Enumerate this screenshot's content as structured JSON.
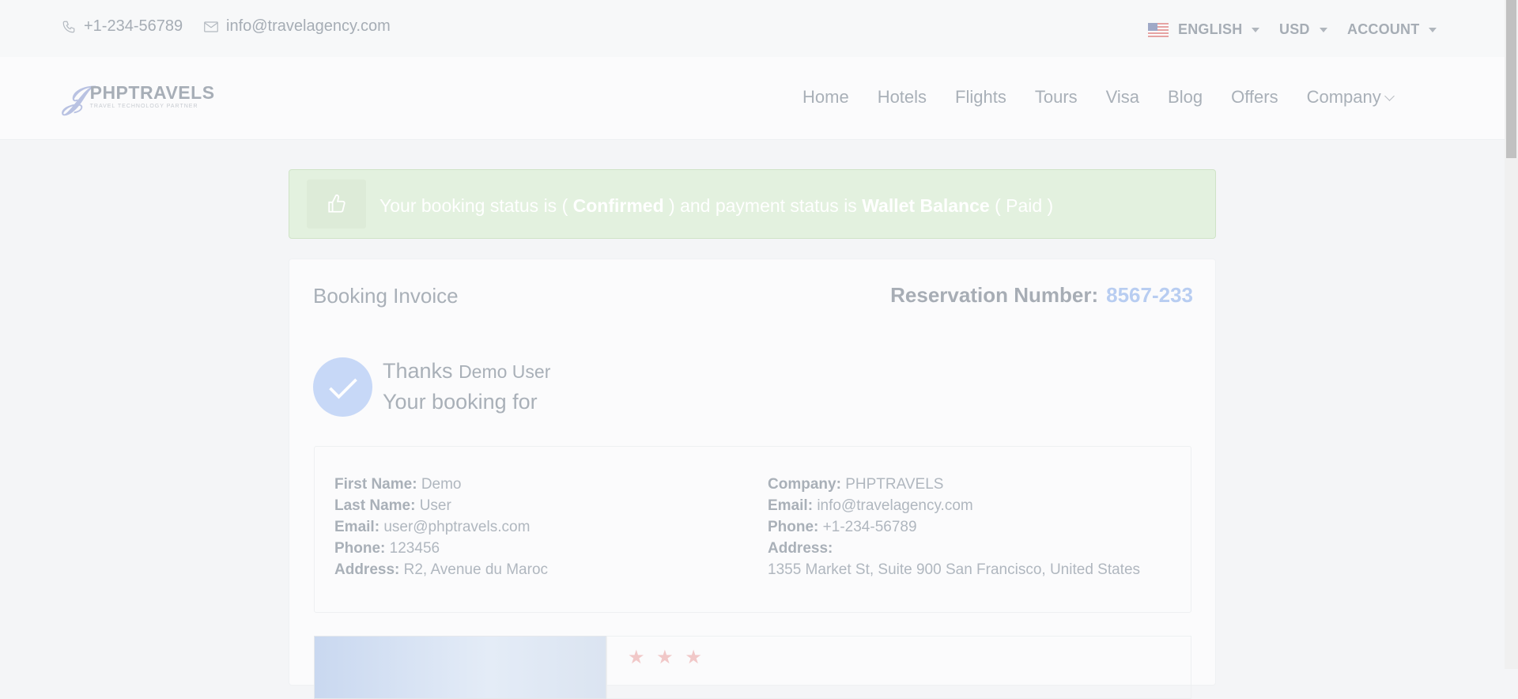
{
  "topbar": {
    "phone": "+1-234-56789",
    "email": "info@travelagency.com",
    "language": "ENGLISH",
    "currency": "USD",
    "account": "ACCOUNT"
  },
  "nav": {
    "logo_main": "PHPTRAVELS",
    "logo_sub": "TRAVEL TECHNOLOGY PARTNER",
    "links": [
      "Home",
      "Hotels",
      "Flights",
      "Tours",
      "Visa",
      "Blog",
      "Offers",
      "Company"
    ]
  },
  "alert": {
    "prefix": "Your booking status is ( ",
    "booking_status": "Confirmed",
    "middle": " ) and payment status is ",
    "payment_method": "Wallet Balance",
    "suffix": " ( Paid )"
  },
  "invoice": {
    "title": "Booking Invoice",
    "reservation_label": "Reservation Number:",
    "reservation_number": "8567-233",
    "thanks": "Thanks",
    "user_name": "Demo User",
    "booking_for": "Your booking for"
  },
  "customer": {
    "first_name_label": "First Name:",
    "first_name": "Demo",
    "last_name_label": "Last Name:",
    "last_name": "User",
    "email_label": "Email:",
    "email": "user@phptravels.com",
    "phone_label": "Phone:",
    "phone": "123456",
    "address_label": "Address:",
    "address": "R2, Avenue du Maroc"
  },
  "company": {
    "company_label": "Company:",
    "company": "PHPTRAVELS",
    "email_label": "Email:",
    "email": "info@travelagency.com",
    "phone_label": "Phone:",
    "phone": "+1-234-56789",
    "address_label": "Address:",
    "address": "1355 Market St, Suite 900 San Francisco, United States"
  },
  "hotel": {
    "stars": "★ ★ ★"
  },
  "colors": {
    "accent": "#b8cdf1",
    "success_bg": "#e3f1df",
    "check_bg": "#c7d8f7"
  },
  "icons": [
    "phone-icon",
    "mail-icon",
    "us-flag-icon",
    "thumbs-up-icon",
    "checkmark-icon",
    "star-icon",
    "chevron-down-icon"
  ]
}
